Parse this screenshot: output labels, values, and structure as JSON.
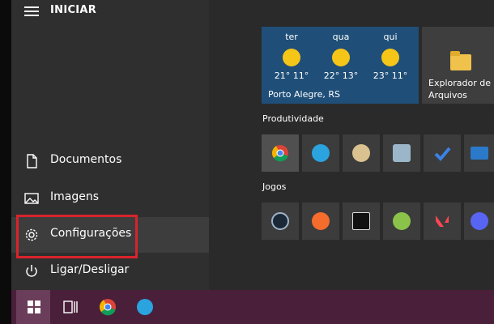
{
  "start_menu": {
    "title": "INICIAR",
    "nav": [
      {
        "label": "Documentos",
        "icon": "document-icon"
      },
      {
        "label": "Imagens",
        "icon": "image-icon"
      },
      {
        "label": "Configurações",
        "icon": "gear-icon",
        "active": true
      },
      {
        "label": "Ligar/Desligar",
        "icon": "power-icon"
      }
    ],
    "highlight_color": "#d8242c"
  },
  "weather": {
    "days": [
      {
        "day": "ter",
        "temp": "21° 11°"
      },
      {
        "day": "qua",
        "temp": "22° 13°"
      },
      {
        "day": "qui",
        "temp": "23° 11°"
      }
    ],
    "location": "Porto Alegre, RS"
  },
  "explorer_tile": {
    "label_line1": "Explorador de",
    "label_line2": "Arquivos"
  },
  "groups": {
    "productivity_title": "Produtividade",
    "games_title": "Jogos",
    "productivity_icons": [
      "chrome-icon",
      "telegram-icon",
      "paint-icon",
      "recycle-bin-icon",
      "todo-check-icon",
      "mail-icon"
    ],
    "games_icons": [
      "steam-icon",
      "origin-icon",
      "epic-games-icon",
      "xbox-icon",
      "valorant-icon",
      "discord-icon"
    ]
  },
  "taskbar": {
    "items": [
      "windows-start-icon",
      "task-view-icon",
      "chrome-icon",
      "telegram-icon"
    ]
  }
}
